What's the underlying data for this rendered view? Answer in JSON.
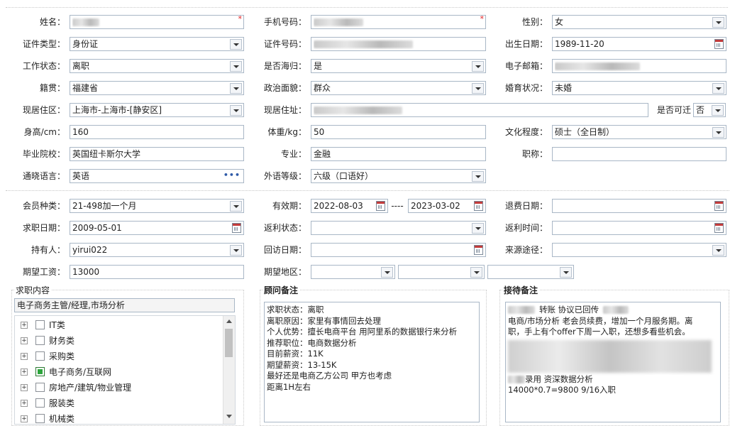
{
  "fields": {
    "name": {
      "label": "姓名：",
      "value": ""
    },
    "mobile": {
      "label": "手机号码：",
      "value": ""
    },
    "gender": {
      "label": "性别：",
      "value": "女"
    },
    "id_type": {
      "label": "证件类型：",
      "value": "身份证"
    },
    "id_number": {
      "label": "证件号码：",
      "value": ""
    },
    "birth_date": {
      "label": "出生日期：",
      "value": "1989-11-20"
    },
    "work_status": {
      "label": "工作状态：",
      "value": "离职"
    },
    "returnee": {
      "label": "是否海归：",
      "value": "是"
    },
    "email": {
      "label": "电子邮箱：",
      "value": ""
    },
    "native_place": {
      "label": "籍贯：",
      "value": "福建省"
    },
    "political": {
      "label": "政治面貌：",
      "value": "群众"
    },
    "marital": {
      "label": "婚育状况：",
      "value": "未婚"
    },
    "residence_area": {
      "label": "现居住区：",
      "value": "上海市-上海市-[静安区]"
    },
    "address": {
      "label": "现居住址：",
      "value": ""
    },
    "relocatable": {
      "label": "是否可迁",
      "value": "否"
    },
    "height": {
      "label": "身高/cm：",
      "value": "160"
    },
    "weight": {
      "label": "体重/kg：",
      "value": "50"
    },
    "education": {
      "label": "文化程度：",
      "value": "硕士（全日制）"
    },
    "school": {
      "label": "毕业院校：",
      "value": "英国纽卡斯尔大学"
    },
    "major": {
      "label": "专业：",
      "value": "金融"
    },
    "title": {
      "label": "职称：",
      "value": ""
    },
    "language": {
      "label": "通晓语言：",
      "value": "英语",
      "more": "•••"
    },
    "language_level": {
      "label": "外语等级：",
      "value": "六级（口语好）"
    },
    "member_type": {
      "label": "会员种类：",
      "value": "21-498加一个月"
    },
    "validity": {
      "label": "有效期：",
      "from": "2022-08-03",
      "sep": "----",
      "to": "2023-03-02"
    },
    "refund_date": {
      "label": "退费日期：",
      "value": ""
    },
    "job_seek_date": {
      "label": "求职日期：",
      "value": "2009-05-01"
    },
    "rebate_status": {
      "label": "返利状态：",
      "value": ""
    },
    "rebate_time": {
      "label": "返利时间：",
      "value": ""
    },
    "holder": {
      "label": "持有人：",
      "value": "yirui022"
    },
    "revisit_date": {
      "label": "回访日期：",
      "value": ""
    },
    "source": {
      "label": "来源途径：",
      "value": ""
    },
    "expected_salary": {
      "label": "期望工资：",
      "value": "13000"
    },
    "expected_region": {
      "label": "期望地区：",
      "v1": "",
      "v2": "",
      "v3": ""
    }
  },
  "job_section": {
    "title": "求职内容",
    "summary": "电子商务主管/经理,市场分析",
    "tree": [
      {
        "label": "IT类",
        "checked": false
      },
      {
        "label": "财务类",
        "checked": false
      },
      {
        "label": "采购类",
        "checked": false
      },
      {
        "label": "电子商务/互联网",
        "checked": true
      },
      {
        "label": "房地产/建筑/物业管理",
        "checked": false
      },
      {
        "label": "服装类",
        "checked": false
      },
      {
        "label": "机械类",
        "checked": false
      }
    ]
  },
  "consultant_notes": {
    "title": "顾问备注",
    "lines": [
      "求职状态：离职",
      "离职原因：家里有事情回去处理",
      "个人优势：擅长电商平台 用阿里系的数据银行来分析",
      "推荐职位：电商数据分析",
      "目前薪资：11K",
      "期望薪资：13-15K",
      "最好还是电商乙方公司 甲方也考虑",
      "距离1H左右"
    ]
  },
  "reception_notes": {
    "title": "接待备注",
    "line1": "转账 协议已回传",
    "line2": "电商/市场分析 老会员续费，增加一个月服务期。离",
    "line3": "职，手上有个offer下周一入职，还想多看些机会。",
    "line4": "录用 资深数据分析",
    "line5": "14000*0.7=9800  9/16入职"
  },
  "colors": {
    "required": "#e0181b",
    "border": "#a9b7c6",
    "checked": "#2da53c"
  }
}
